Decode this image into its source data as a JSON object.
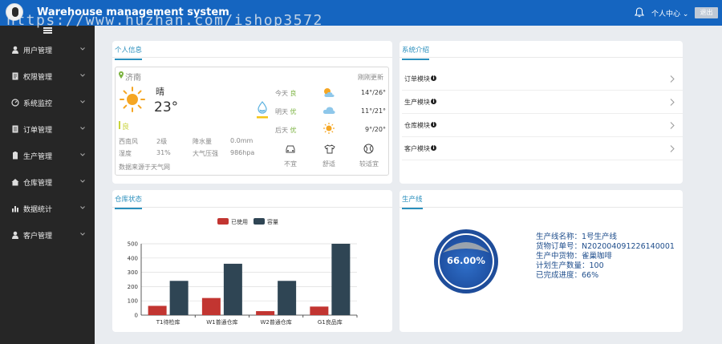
{
  "header": {
    "title": "Warehouse management system",
    "user_center": "个人中心",
    "logout": "退出",
    "watermark": "https://www.huzhan.com/ishop3572"
  },
  "sidebar": {
    "items": [
      {
        "label": "用户管理",
        "icon": "user-icon"
      },
      {
        "label": "权限管理",
        "icon": "document-icon"
      },
      {
        "label": "系统监控",
        "icon": "monitor-icon"
      },
      {
        "label": "订单管理",
        "icon": "order-icon"
      },
      {
        "label": "生产管理",
        "icon": "production-icon"
      },
      {
        "label": "仓库管理",
        "icon": "warehouse-icon"
      },
      {
        "label": "数据统计",
        "icon": "bar-chart-icon"
      },
      {
        "label": "客户管理",
        "icon": "customer-icon"
      }
    ]
  },
  "personal": {
    "tab": "个人信息",
    "weather": {
      "city": "济南",
      "updated": "刚刚更新",
      "condition": "晴",
      "temperature": "23°",
      "aqi": "良",
      "details": [
        {
          "label": "西南风",
          "value": "2级"
        },
        {
          "label": "降水量",
          "value": "0.0mm"
        },
        {
          "label": "湿度",
          "value": "31%"
        },
        {
          "label": "大气压强",
          "value": "986hpa"
        }
      ],
      "source": "数据来源于天气网",
      "forecast": [
        {
          "day": "今天",
          "quality": "良",
          "range": "14°/26°"
        },
        {
          "day": "明天",
          "quality": "优",
          "range": "11°/21°"
        },
        {
          "day": "后天",
          "quality": "优",
          "range": "9°/20°"
        }
      ],
      "life_index": [
        {
          "label": "不宜",
          "icon": "car-icon"
        },
        {
          "label": "舒适",
          "icon": "shirt-icon"
        },
        {
          "label": "较适宜",
          "icon": "ball-icon"
        }
      ]
    }
  },
  "intro": {
    "tab": "系统介绍",
    "items": [
      "订单模块",
      "生产模块",
      "仓库模块",
      "客户模块"
    ]
  },
  "warehouse": {
    "tab": "仓库状态"
  },
  "production": {
    "tab": "生产线",
    "progress": 0.66,
    "progress_label": "66.00%",
    "info": [
      "生产线名称：1号生产线",
      "货物订单号：N202004091226140001",
      "生产中货物：雀巢咖啡",
      "计划生产数量：100",
      "已完成进度：66%"
    ]
  },
  "chart_data": {
    "type": "bar",
    "categories": [
      "T1待检库",
      "W1普通仓库",
      "W2普通仓库",
      "G1良品库"
    ],
    "series": [
      {
        "name": "已使用",
        "values": [
          65,
          120,
          28,
          60
        ],
        "color": "#c23531"
      },
      {
        "name": "容量",
        "values": [
          240,
          360,
          240,
          500
        ],
        "color": "#2f4554"
      }
    ],
    "ylim": [
      0,
      500
    ],
    "yticks": [
      0,
      100,
      200,
      300,
      400,
      500
    ],
    "legend": "top-center",
    "grid": true
  }
}
